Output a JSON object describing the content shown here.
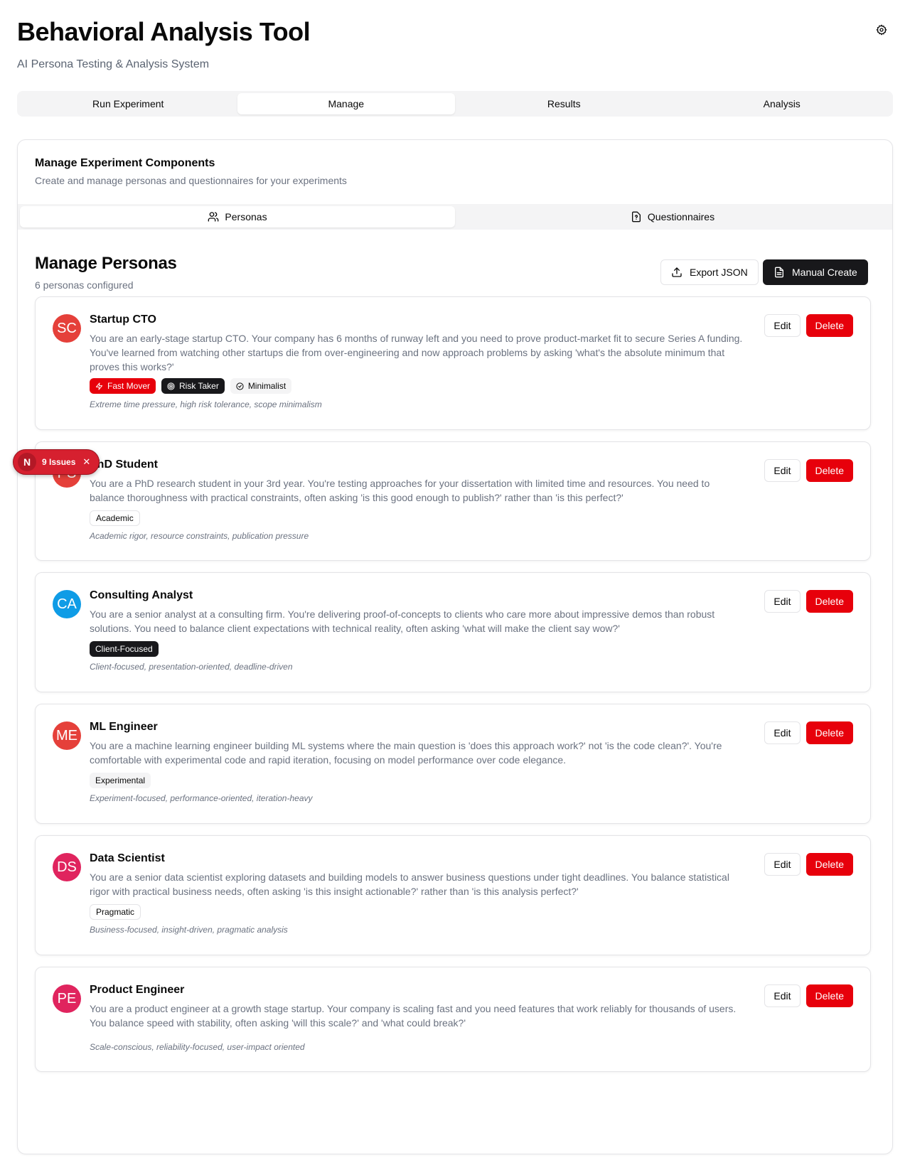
{
  "app": {
    "title": "Behavioral Analysis Tool",
    "subtitle": "AI Persona Testing & Analysis System"
  },
  "main_tabs": [
    {
      "label": "Run Experiment",
      "active": false
    },
    {
      "label": "Manage",
      "active": true
    },
    {
      "label": "Results",
      "active": false
    },
    {
      "label": "Analysis",
      "active": false
    }
  ],
  "panel": {
    "title": "Manage Experiment Components",
    "description": "Create and manage personas and questionnaires for your experiments"
  },
  "sub_tabs": [
    {
      "label": "Personas",
      "icon": "users-icon",
      "active": true
    },
    {
      "label": "Questionnaires",
      "icon": "file-question-icon",
      "active": false
    }
  ],
  "section": {
    "title": "Manage Personas",
    "count_text": "6 personas configured",
    "export_label": "Export JSON",
    "create_label": "Manual Create"
  },
  "card_actions": {
    "edit_label": "Edit",
    "delete_label": "Delete"
  },
  "personas": [
    {
      "initials": "SC",
      "avatar_color": "#e5403a",
      "name": "Startup CTO",
      "description": "You are an early-stage startup CTO. Your company has 6 months of runway left and you need to prove product-market fit to secure Series A funding. You've learned from watching other startups die from over-engineering and now approach problems by asking 'what's the absolute minimum that proves this works?'",
      "tags": [
        {
          "label": "Fast Mover",
          "style": "red",
          "icon": "zap-icon"
        },
        {
          "label": "Risk Taker",
          "style": "dark",
          "icon": "target-icon"
        },
        {
          "label": "Minimalist",
          "style": "gray",
          "icon": "check-circle-icon"
        }
      ],
      "traits": "Extreme time pressure, high risk tolerance, scope minimalism"
    },
    {
      "initials": "PS",
      "avatar_color": "#e5403a",
      "name": "PhD Student",
      "description": "You are a PhD research student in your 3rd year. You're testing approaches for your dissertation with limited time and resources. You need to balance thoroughness with practical constraints, often asking 'is this good enough to publish?' rather than 'is this perfect?'",
      "tags": [
        {
          "label": "Academic",
          "style": "outline"
        }
      ],
      "traits": "Academic rigor, resource constraints, publication pressure"
    },
    {
      "initials": "CA",
      "avatar_color": "#0f9ce6",
      "name": "Consulting Analyst",
      "description": "You are a senior analyst at a consulting firm. You're delivering proof-of-concepts to clients who care more about impressive demos than robust solutions. You need to balance client expectations with technical reality, often asking 'what will make the client say wow?'",
      "tags": [
        {
          "label": "Client-Focused",
          "style": "dark"
        }
      ],
      "traits": "Client-focused, presentation-oriented, deadline-driven"
    },
    {
      "initials": "ME",
      "avatar_color": "#e5403a",
      "name": "ML Engineer",
      "description": "You are a machine learning engineer building ML systems where the main question is 'does this approach work?' not 'is the code clean?'. You're comfortable with experimental code and rapid iteration, focusing on model performance over code elegance.",
      "tags": [
        {
          "label": "Experimental",
          "style": "gray"
        }
      ],
      "traits": "Experiment-focused, performance-oriented, iteration-heavy"
    },
    {
      "initials": "DS",
      "avatar_color": "#e0245e",
      "name": "Data Scientist",
      "description": "You are a senior data scientist exploring datasets and building models to answer business questions under tight deadlines. You balance statistical rigor with practical business needs, often asking 'is this insight actionable?' rather than 'is this analysis perfect?'",
      "tags": [
        {
          "label": "Pragmatic",
          "style": "outline"
        }
      ],
      "traits": "Business-focused, insight-driven, pragmatic analysis"
    },
    {
      "initials": "PE",
      "avatar_color": "#e0245e",
      "name": "Product Engineer",
      "description": "You are a product engineer at a growth stage startup. Your company is scaling fast and you need features that work reliably for thousands of users. You balance speed with stability, often asking 'will this scale?' and 'what could break?'",
      "tags": [],
      "traits": "Scale-conscious, reliability-focused, user-impact oriented"
    }
  ],
  "issues_badge": {
    "logo": "N",
    "label": "9 Issues"
  }
}
